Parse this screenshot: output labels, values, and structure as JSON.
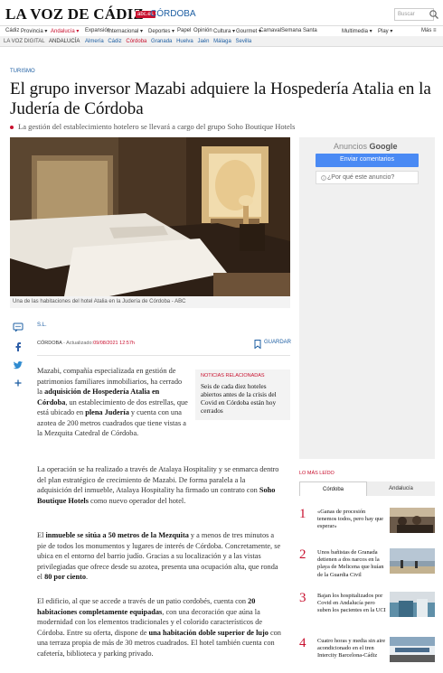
{
  "header": {
    "logo": "LA VOZ DE CÁDIZ",
    "logo_badge": "abc.es",
    "edition": "CÓRDOBA",
    "search_placeholder": "Buscar"
  },
  "nav_primary": {
    "items": [
      "Cádiz",
      "Provincia ▾",
      "Andalucía ▾",
      "Expansión",
      "Internacional ▾",
      "Deportes ▾",
      "Papel",
      "Opinión",
      "Cultura ▾",
      "Gourmet ▾",
      "Carnaval",
      "Semana Santa",
      "Multimedia ▾",
      "Play ▾",
      "Más ≡"
    ],
    "active": "Andalucía ▾"
  },
  "nav_secondary": {
    "tag1": "LA VOZ DIGITAL",
    "tag2": "ANDALUCÍA",
    "cities": [
      "Almería",
      "Cádiz",
      "Córdoba",
      "Granada",
      "Huelva",
      "Jaén",
      "Málaga",
      "Sevilla"
    ],
    "active_city": "Córdoba"
  },
  "article": {
    "section": "TURISMO",
    "title": "El grupo inversor Mazabi adquiere la Hospedería Atalia en la Judería de Córdoba",
    "subtitle": "La gestión del establecimiento hotelero se llevará a cargo del grupo Soho Boutique Hotels",
    "photo_caption": "Una de las habitaciones del hotel Atalia en la Judería de Córdoba - ABC",
    "author": "S.L.",
    "location": "CÓRDOBA",
    "updated_label": "Actualizado:",
    "date": "09/08/2021 12:57h",
    "save_label": "GUARDAR",
    "paragraphs": {
      "p1_a": "Mazabi, compañía especializada en gestión de patrimonios familiares inmobiliarios, ha cerrado la ",
      "p1_b": "adquisición de Hospedería Atalia en Córdoba",
      "p1_c": ", un establecimiento de dos estrellas, que está ubicado en ",
      "p1_d": "plena Judería",
      "p1_e": " y cuenta con una azotea de 200 metros cuadrados que tiene vistas a la Mezquita Catedral de Córdoba.",
      "p2_a": "La operación se ha realizado a través de Atalaya Hospitality y se enmarca dentro del plan estratégico de crecimiento de Mazabi. De forma paralela a la adquisición del inmueble, Atalaya Hospitality ha firmado un contrato con ",
      "p2_b": "Soho Boutique Hotels",
      "p2_c": " como nuevo operador del hotel.",
      "p3_a": "El ",
      "p3_b": "inmueble se sitúa a 50 metros de la Mezquita",
      "p3_c": " y a menos de tres minutos a pie de todos los monumentos y lugares de interés de Córdoba. Concretamente, se ubica en el entorno del barrio judío. Gracias a su localización y a las vistas privilegiadas que ofrece desde su azotea, presenta una ocupación alta, que ronda el ",
      "p3_d": "80 por ciento",
      "p3_e": ".",
      "p4_a": "El edificio, al que se accede a través de un patio cordobés, cuenta con ",
      "p4_b": "20 habitaciones completamente equipadas",
      "p4_c": ", con una decoración que aúna la modernidad con los elementos tradicionales y el colorido característicos de Córdoba. Entre su oferta, dispone de ",
      "p4_d": "una habitación doble superior de lujo",
      "p4_e": " con una terraza propia de más de 30 metros cuadrados. El hotel también cuenta con cafetería, biblioteca y parking privado."
    },
    "related": {
      "title": "NOTICIAS RELACIONADAS",
      "text": "Seis de cada diez hoteles abiertos antes de la crisis del Covid en Córdoba están hoy cerrados"
    }
  },
  "ads": {
    "label_prefix": "Anuncios",
    "label_brand": "Google",
    "send_feedback": "Enviar comentarios",
    "why_ad": "¿Por qué este anuncio?"
  },
  "most_read": {
    "title": "LO MÁS LEÍDO",
    "tabs": [
      "Córdoba",
      "Andalucía"
    ],
    "items": [
      {
        "num": "1",
        "text": "«Ganas de procesión tenemos todos, pero hay que esperar»"
      },
      {
        "num": "2",
        "text": "Unos bañistas de Granada detienen a dos narcos en la playa de Melicena que huían de la Guardia Civil"
      },
      {
        "num": "3",
        "text": "Bajan los hospitalizados por Covid en Andalucía pero suben los pacientes en la UCI"
      },
      {
        "num": "4",
        "text": "Cuatro horas y media sin aire acondicionado en el tren Intercity Barcelona-Cádiz"
      }
    ]
  },
  "colors": {
    "accent_red": "#c8102e",
    "link_blue": "#1e5fa3",
    "ad_blue": "#4a8af4"
  }
}
